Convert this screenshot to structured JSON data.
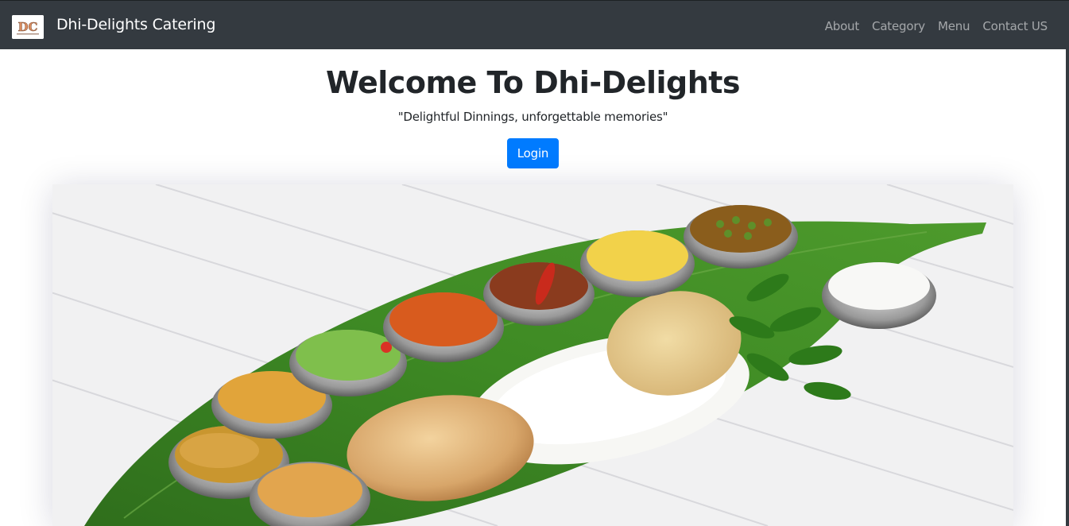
{
  "navbar": {
    "brand_name": "Dhi-Delights Catering",
    "logo_letters": "DC",
    "links": [
      "About",
      "Category",
      "Menu",
      "Contact US"
    ]
  },
  "hero": {
    "title": "Welcome To Dhi-Delights",
    "subtitle": "\"Delightful Dinnings, unforgettable memories\"",
    "login_label": "Login"
  },
  "colors": {
    "navbar_bg": "#343a40",
    "primary_button": "#007bff",
    "nav_link": "rgba(255,255,255,0.55)"
  },
  "image": {
    "subject": "banana-leaf-meal"
  }
}
